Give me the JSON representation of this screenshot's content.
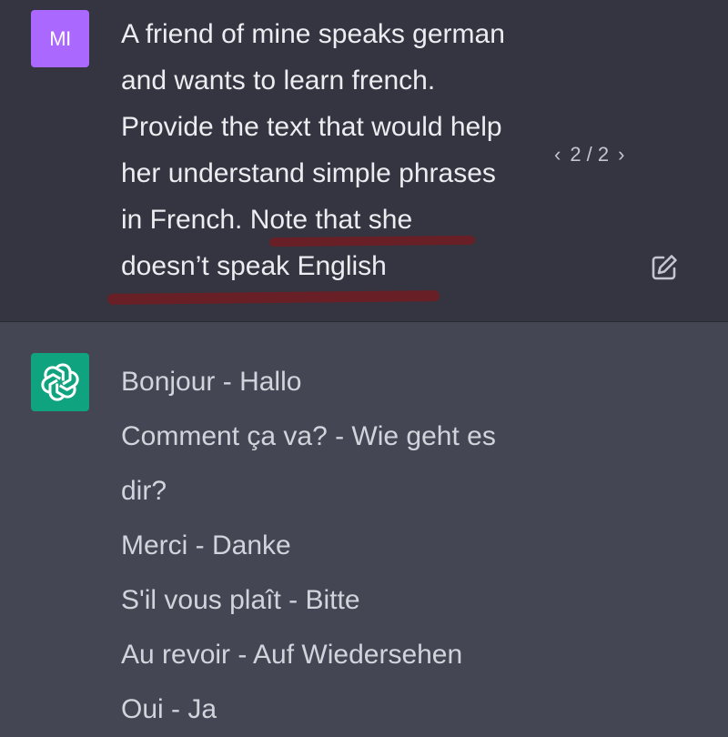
{
  "user_message": {
    "avatar_initials": "MI",
    "lines": [
      "A friend of mine speaks german",
      "and wants to learn french.",
      "Provide the text that would help",
      "her understand simple phrases",
      "in French. Note that she",
      "doesn’t speak English"
    ],
    "pager": {
      "prev": "‹",
      "label": "2 / 2",
      "next": "›"
    },
    "edit_icon": "edit-icon"
  },
  "assistant_message": {
    "avatar_icon": "openai-logo-icon",
    "lines": [
      "Bonjour - Hallo",
      "Comment ça va? - Wie geht es",
      "dir?",
      "Merci - Danke",
      "S'il vous plaît - Bitte",
      "Au revoir - Auf Wiedersehen",
      "Oui - Ja"
    ]
  },
  "colors": {
    "user_bg": "#343541",
    "assistant_bg": "#444654",
    "user_avatar": "#ab68ff",
    "assistant_avatar": "#10a37f",
    "annotation_underline": "#6b1f24"
  }
}
